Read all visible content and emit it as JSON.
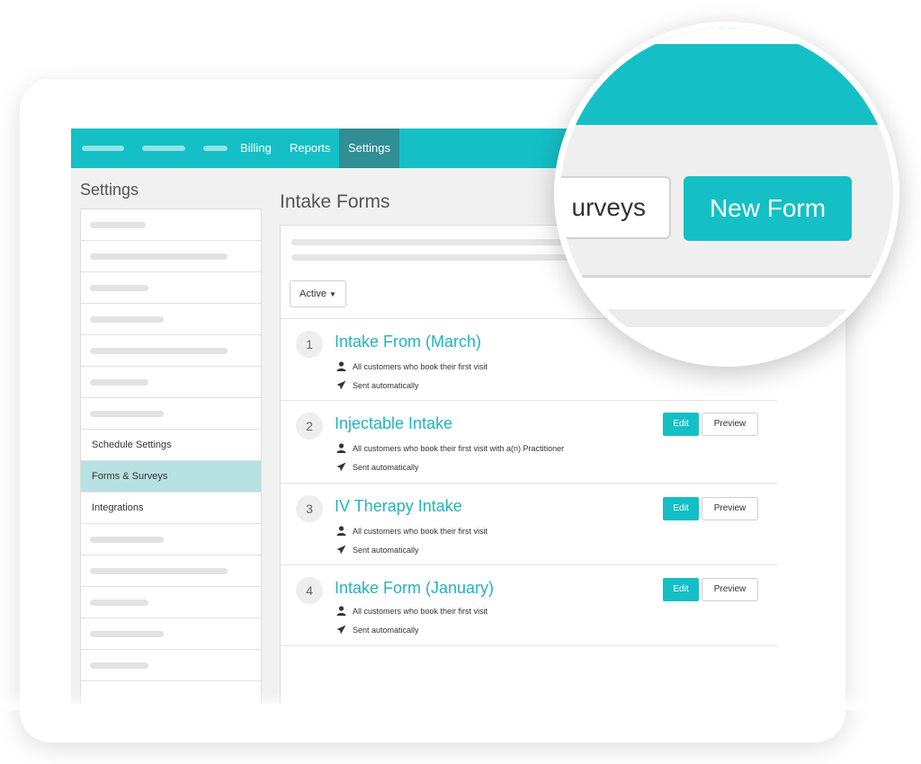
{
  "nav": {
    "items": [
      "Billing",
      "Reports",
      "Settings"
    ],
    "active": "Settings"
  },
  "sidebar": {
    "title": "Settings",
    "items": [
      "Schedule Settings",
      "Forms & Surveys",
      "Integrations"
    ],
    "active": "Forms & Surveys"
  },
  "main": {
    "title": "Intake Forms",
    "filter_label": "Active",
    "forms": [
      {
        "number": "1",
        "name": "Intake From (March)",
        "audience": "All customers who book their first visit",
        "delivery": "Sent automatically"
      },
      {
        "number": "2",
        "name": "Injectable Intake",
        "audience": "All customers who book their first visit with a(n) Practitioner",
        "delivery": "Sent automatically",
        "edit": "Edit",
        "preview": "Preview"
      },
      {
        "number": "3",
        "name": "IV Therapy Intake",
        "audience": "All customers who book their first visit",
        "delivery": "Sent automatically",
        "edit": "Edit",
        "preview": "Preview"
      },
      {
        "number": "4",
        "name": "Intake Form (January)",
        "audience": "All customers who book their first visit",
        "delivery": "Sent automatically",
        "edit": "Edit",
        "preview": "Preview"
      }
    ]
  },
  "magnifier": {
    "surveys_label": "urveys",
    "new_form_label": "New Form"
  },
  "colors": {
    "accent": "#14bfc6",
    "nav_active": "#2f8f94",
    "sidebar_active": "#b8e2e2",
    "link": "#22b4bd"
  }
}
